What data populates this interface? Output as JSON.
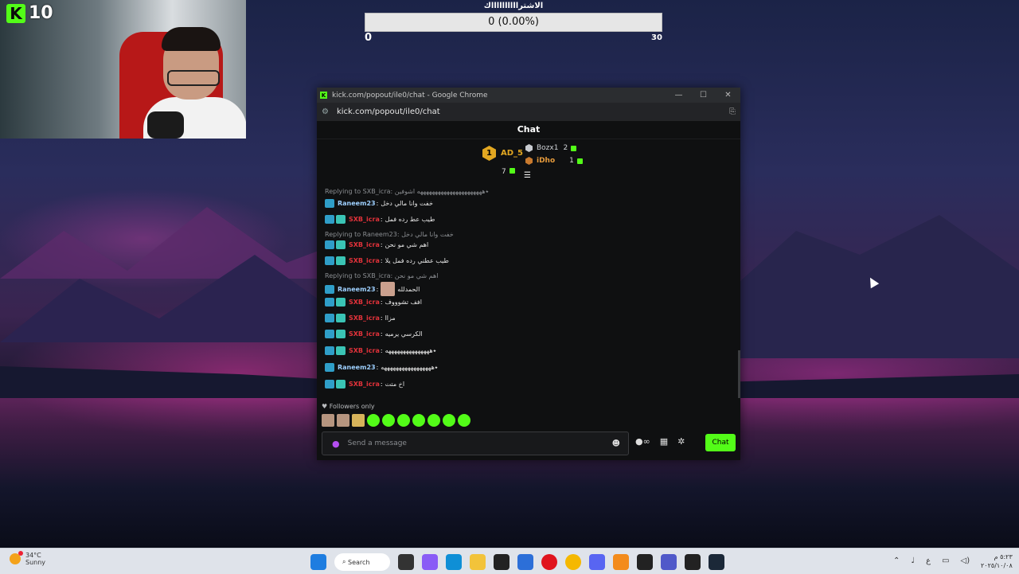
{
  "stream": {
    "kick_count": "10"
  },
  "goal": {
    "title": "الاشترااااااااااك",
    "value_text": "0 (0.00%)",
    "min": "0",
    "max": "30",
    "progress": 0
  },
  "window": {
    "title": "kick.com/popout/ile0/chat - Google Chrome",
    "url": "kick.com/popout/ile0/chat",
    "chat_header": "Chat"
  },
  "leaderboard": {
    "first": {
      "rank": "1",
      "name": "AD_5",
      "count": "7"
    },
    "second": {
      "name": "Bozx1",
      "count": "2"
    },
    "third": {
      "name": "iDho",
      "count": "1"
    }
  },
  "messages": [
    {
      "type": "reply",
      "text": "Replying to SXB_icra: ٭ههههههههههههههههههههههه اشوفين"
    },
    {
      "type": "msg",
      "user": "Raneem23",
      "color": "blue",
      "text": "خفت وانا مالي دخل"
    },
    {
      "type": "msg",
      "user": "SXB_icra",
      "color": "red",
      "text": "طيب عط رده فمل"
    },
    {
      "type": "reply",
      "text": "Replying to Raneem23: خفت وانا مالي دخل"
    },
    {
      "type": "msg",
      "user": "SXB_icra",
      "color": "red",
      "text": "اهم شي مو نحن"
    },
    {
      "type": "msg",
      "user": "SXB_icra",
      "color": "red",
      "text": "طيب عطني رده فمل يلا"
    },
    {
      "type": "reply",
      "text": "Replying to SXB_icra: اهم شي مو نحن"
    },
    {
      "type": "msg",
      "user": "Raneem23",
      "color": "blue",
      "text": "الحمدلله",
      "emote": true
    },
    {
      "type": "msg",
      "user": "SXB_icra",
      "color": "red",
      "text": "افف تشوووف"
    },
    {
      "type": "msg",
      "user": "SXB_icra",
      "color": "red",
      "text": "مزاا"
    },
    {
      "type": "msg",
      "user": "SXB_icra",
      "color": "red",
      "text": "الكرسي يرميه"
    },
    {
      "type": "msg",
      "user": "SXB_icra",
      "color": "red",
      "text": "٭هههههههههههههههه"
    },
    {
      "type": "msg",
      "user": "Raneem23",
      "color": "blue",
      "text": "٭هههههههههههههههههه"
    },
    {
      "type": "msg",
      "user": "SXB_icra",
      "color": "red",
      "text": "اخ متت"
    }
  ],
  "footer": {
    "followers_only": "Followers only",
    "input_placeholder": "Send a message",
    "chat_button": "Chat"
  },
  "taskbar": {
    "temp": "34°C",
    "condition": "Sunny",
    "search_label": "Search",
    "lang": "ع",
    "time": "٥:٢٣ م",
    "date": "٢٠٢٥/١٠/٠٨"
  },
  "colors": {
    "kick_green": "#53fc18",
    "gold": "#e2a721",
    "user_red": "#e2323a"
  }
}
